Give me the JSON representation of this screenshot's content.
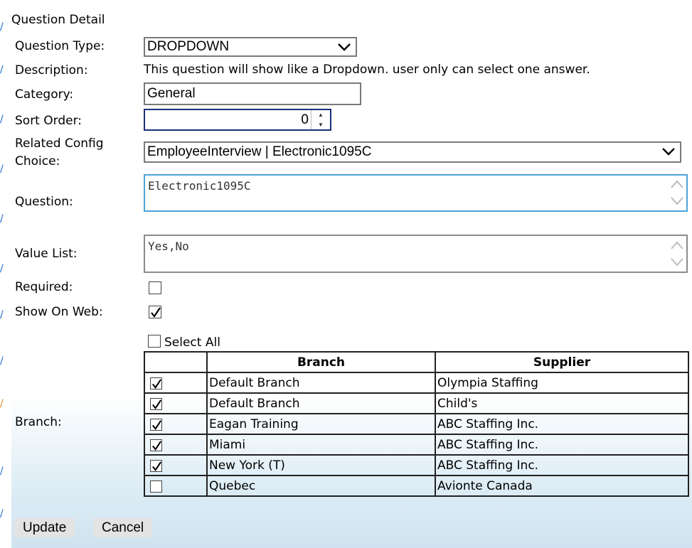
{
  "title": "Question Detail",
  "labels": {
    "question_type": "Question Type:",
    "description": "Description:",
    "category": "Category:",
    "sort_order": "Sort Order:",
    "related_config_1": "Related Config",
    "related_config_2": "Choice:",
    "question": "Question:",
    "value_list": "Value List:",
    "required": "Required:",
    "show_on_web": "Show On Web:",
    "branch": "Branch:"
  },
  "fields": {
    "question_type": "DROPDOWN",
    "description": "This question will show like a Dropdown. user only can select one answer.",
    "category": "General",
    "sort_order": "0",
    "related_config_choice": "EmployeeInterview | Electronic1095C",
    "question": "Electronic1095C",
    "value_list": "Yes,No",
    "required": false,
    "show_on_web": true
  },
  "select_all_label": "Select All",
  "branch_table": {
    "headers": [
      "",
      "Branch",
      "Supplier"
    ],
    "rows": [
      {
        "checked": true,
        "branch": "Default Branch",
        "supplier": "Olympia Staffing"
      },
      {
        "checked": true,
        "branch": "Default Branch",
        "supplier": "Child's"
      },
      {
        "checked": true,
        "branch": "Eagan Training",
        "supplier": "ABC Staffing Inc."
      },
      {
        "checked": true,
        "branch": "Miami",
        "supplier": "ABC Staffing Inc."
      },
      {
        "checked": true,
        "branch": "New York (T)",
        "supplier": "ABC Staffing Inc."
      },
      {
        "checked": false,
        "branch": "Quebec",
        "supplier": "Avionte Canada"
      }
    ]
  },
  "buttons": {
    "update": "Update",
    "cancel": "Cancel"
  },
  "colors": {
    "focus_border": "#1a2f7a",
    "question_border": "#4aa3d8",
    "edge_accent": "#1f6fd1"
  }
}
